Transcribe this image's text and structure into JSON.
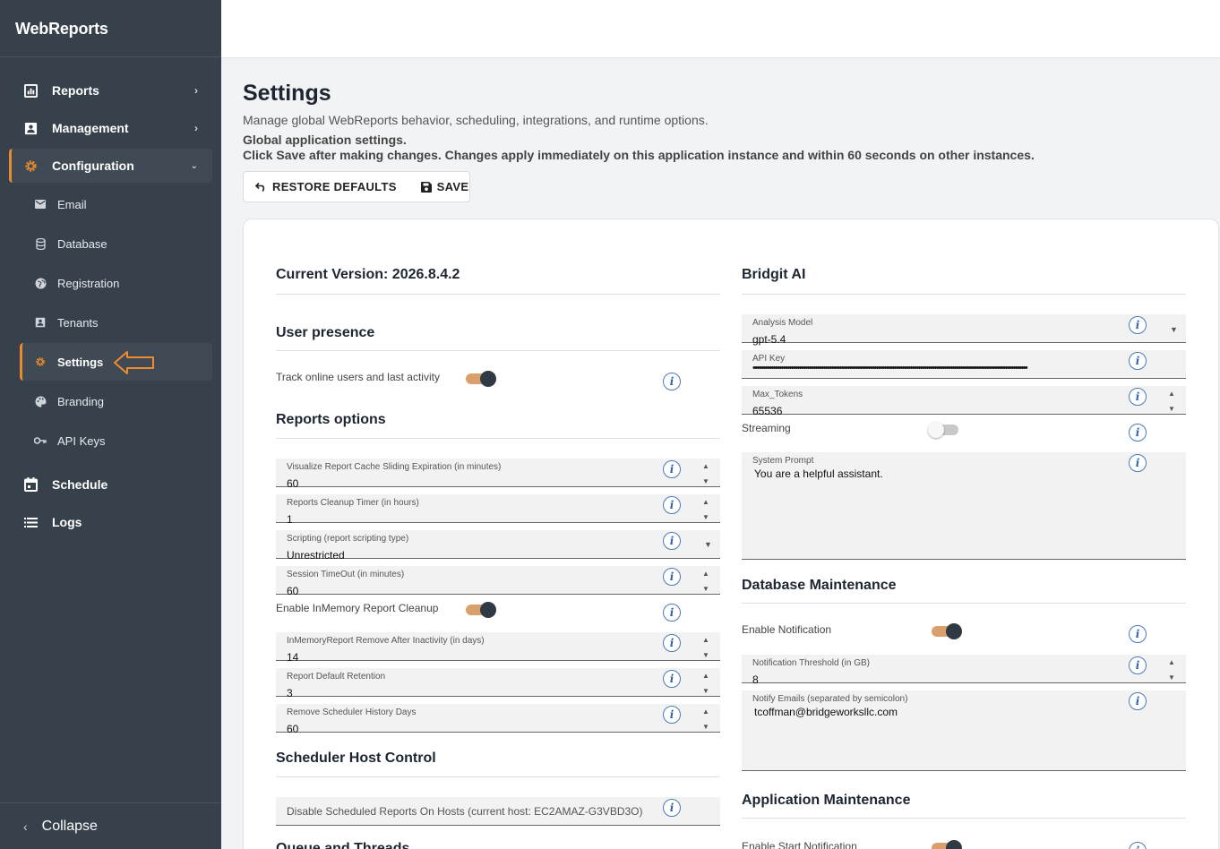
{
  "app": {
    "title": "WebReports"
  },
  "sidebar": {
    "items": [
      {
        "label": "Reports",
        "icon": "bar-chart-icon"
      },
      {
        "label": "Management",
        "icon": "id-card-icon"
      },
      {
        "label": "Configuration",
        "icon": "gear-icon"
      },
      {
        "label": "Schedule",
        "icon": "calendar-icon"
      },
      {
        "label": "Logs",
        "icon": "list-icon"
      }
    ],
    "subitems": [
      {
        "label": "Email",
        "icon": "mail-icon"
      },
      {
        "label": "Database",
        "icon": "database-icon"
      },
      {
        "label": "Registration",
        "icon": "globe-icon"
      },
      {
        "label": "Tenants",
        "icon": "id-card-icon"
      },
      {
        "label": "Settings",
        "icon": "gear-icon"
      },
      {
        "label": "Branding",
        "icon": "palette-icon"
      },
      {
        "label": "API Keys",
        "icon": "key-icon"
      }
    ],
    "collapse_label": "Collapse",
    "accent": "#e88a2e"
  },
  "page": {
    "title": "Settings",
    "description": "Manage global WebReports behavior, scheduling, integrations, and runtime options.",
    "note_title": "Global application settings.",
    "note_text": "Click Save after making changes. Changes apply immediately on this application instance and within 60 seconds on other instances."
  },
  "toolbar": {
    "restore_label": "RESTORE DEFAULTS",
    "save_label": "SAVE"
  },
  "left": {
    "version": "Current Version: 2026.8.4.2",
    "user_presence": {
      "title": "User presence",
      "track_label": "Track online users and last activity",
      "track_on": true
    },
    "reports_options": {
      "title": "Reports options",
      "cache_label": "Visualize Report Cache Sliding Expiration (in minutes)",
      "cache_value": "60",
      "cleanup_label": "Reports Cleanup Timer (in hours)",
      "cleanup_value": "1",
      "scripting_label": "Scripting (report scripting type)",
      "scripting_value": "Unrestricted",
      "timeout_label": "Session TimeOut (in minutes)",
      "timeout_value": "60",
      "inmemory_label": "Enable InMemory Report Cleanup",
      "inmemory_on": true,
      "inactivity_label": "InMemoryReport Remove After Inactivity (in days)",
      "inactivity_value": "14",
      "retention_label": "Report Default Retention",
      "retention_value": "3",
      "history_label": "Remove Scheduler History Days",
      "history_value": "60"
    },
    "scheduler": {
      "title": "Scheduler Host Control",
      "disable_label": "Disable Scheduled Reports On Hosts (current host: EC2AMAZ-G3VBD3O)"
    },
    "queue_title": "Queue and Threads"
  },
  "right": {
    "bridgit": {
      "title": "Bridgit AI",
      "model_label": "Analysis Model",
      "model_value": "gpt-5.4",
      "apikey_label": "API Key",
      "apikey_value": "••••••••••••••••••••••••••••••••••••••••••••••••••••••••••••••••••••••••••••••••••••••••••••••••••••••••••••••••••••••••••••••••••••••••",
      "maxtokens_label": "Max_Tokens",
      "maxtokens_value": "65536",
      "streaming_label": "Streaming",
      "streaming_on": false,
      "prompt_label": "System Prompt",
      "prompt_value": "You are a helpful assistant."
    },
    "db_maintenance": {
      "title": "Database Maintenance",
      "notify_label": "Enable Notification",
      "notify_on": true,
      "threshold_label": "Notification Threshold (in GB)",
      "threshold_value": "8",
      "emails_label": "Notify Emails (separated by semicolon)",
      "emails_value": "tcoffman@bridgeworksllc.com"
    },
    "app_maintenance": {
      "title": "Application Maintenance",
      "start_label": "Enable Start Notification",
      "start_on": true
    }
  }
}
